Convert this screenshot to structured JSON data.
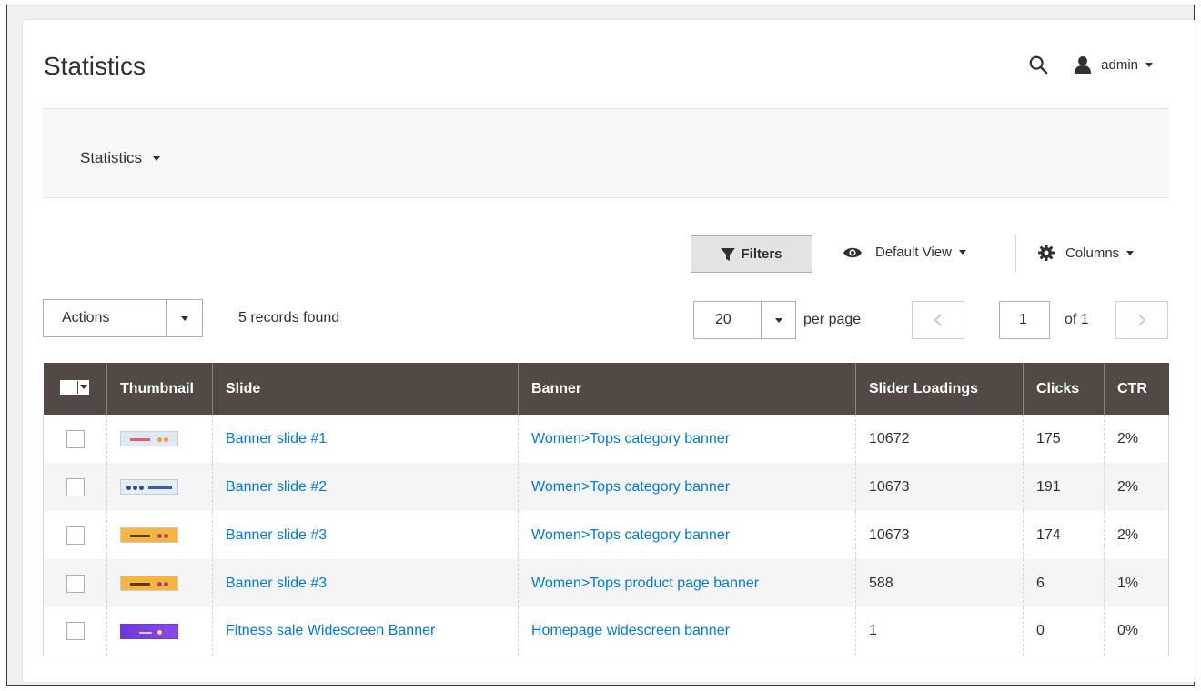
{
  "header": {
    "title": "Statistics",
    "user": "admin"
  },
  "store_switcher": {
    "label": "Statistics"
  },
  "toolbar": {
    "filters_label": "Filters",
    "view_label": "Default View",
    "columns_label": "Columns",
    "actions_label": "Actions",
    "records_found": "5 records found",
    "per_page_value": "20",
    "per_page_label": "per page",
    "page_value": "1",
    "page_of": "of 1"
  },
  "table": {
    "headers": {
      "thumbnail": "Thumbnail",
      "slide": "Slide",
      "banner": "Banner",
      "loadings": "Slider Loadings",
      "clicks": "Clicks",
      "ctr": "CTR"
    },
    "rows": [
      {
        "thumb": "light-pink",
        "slide": "Banner slide #1",
        "banner": "Women>Tops category banner",
        "loadings": "10672",
        "clicks": "175",
        "ctr": "2%"
      },
      {
        "thumb": "light-blue",
        "slide": "Banner slide #2",
        "banner": "Women>Tops category banner",
        "loadings": "10673",
        "clicks": "191",
        "ctr": "2%"
      },
      {
        "thumb": "orange",
        "slide": "Banner slide #3",
        "banner": "Women>Tops category banner",
        "loadings": "10673",
        "clicks": "174",
        "ctr": "2%"
      },
      {
        "thumb": "orange",
        "slide": "Banner slide #3",
        "banner": "Women>Tops product page banner",
        "loadings": "588",
        "clicks": "6",
        "ctr": "1%"
      },
      {
        "thumb": "purple",
        "slide": "Fitness sale Widescreen Banner",
        "banner": "Homepage widescreen banner",
        "loadings": "1",
        "clicks": "0",
        "ctr": "0%"
      }
    ]
  },
  "colors": {
    "header_bg": "#514943",
    "link": "#007bdb",
    "accent_orange": "#f5b540",
    "accent_purple": "#6a3ad6"
  }
}
